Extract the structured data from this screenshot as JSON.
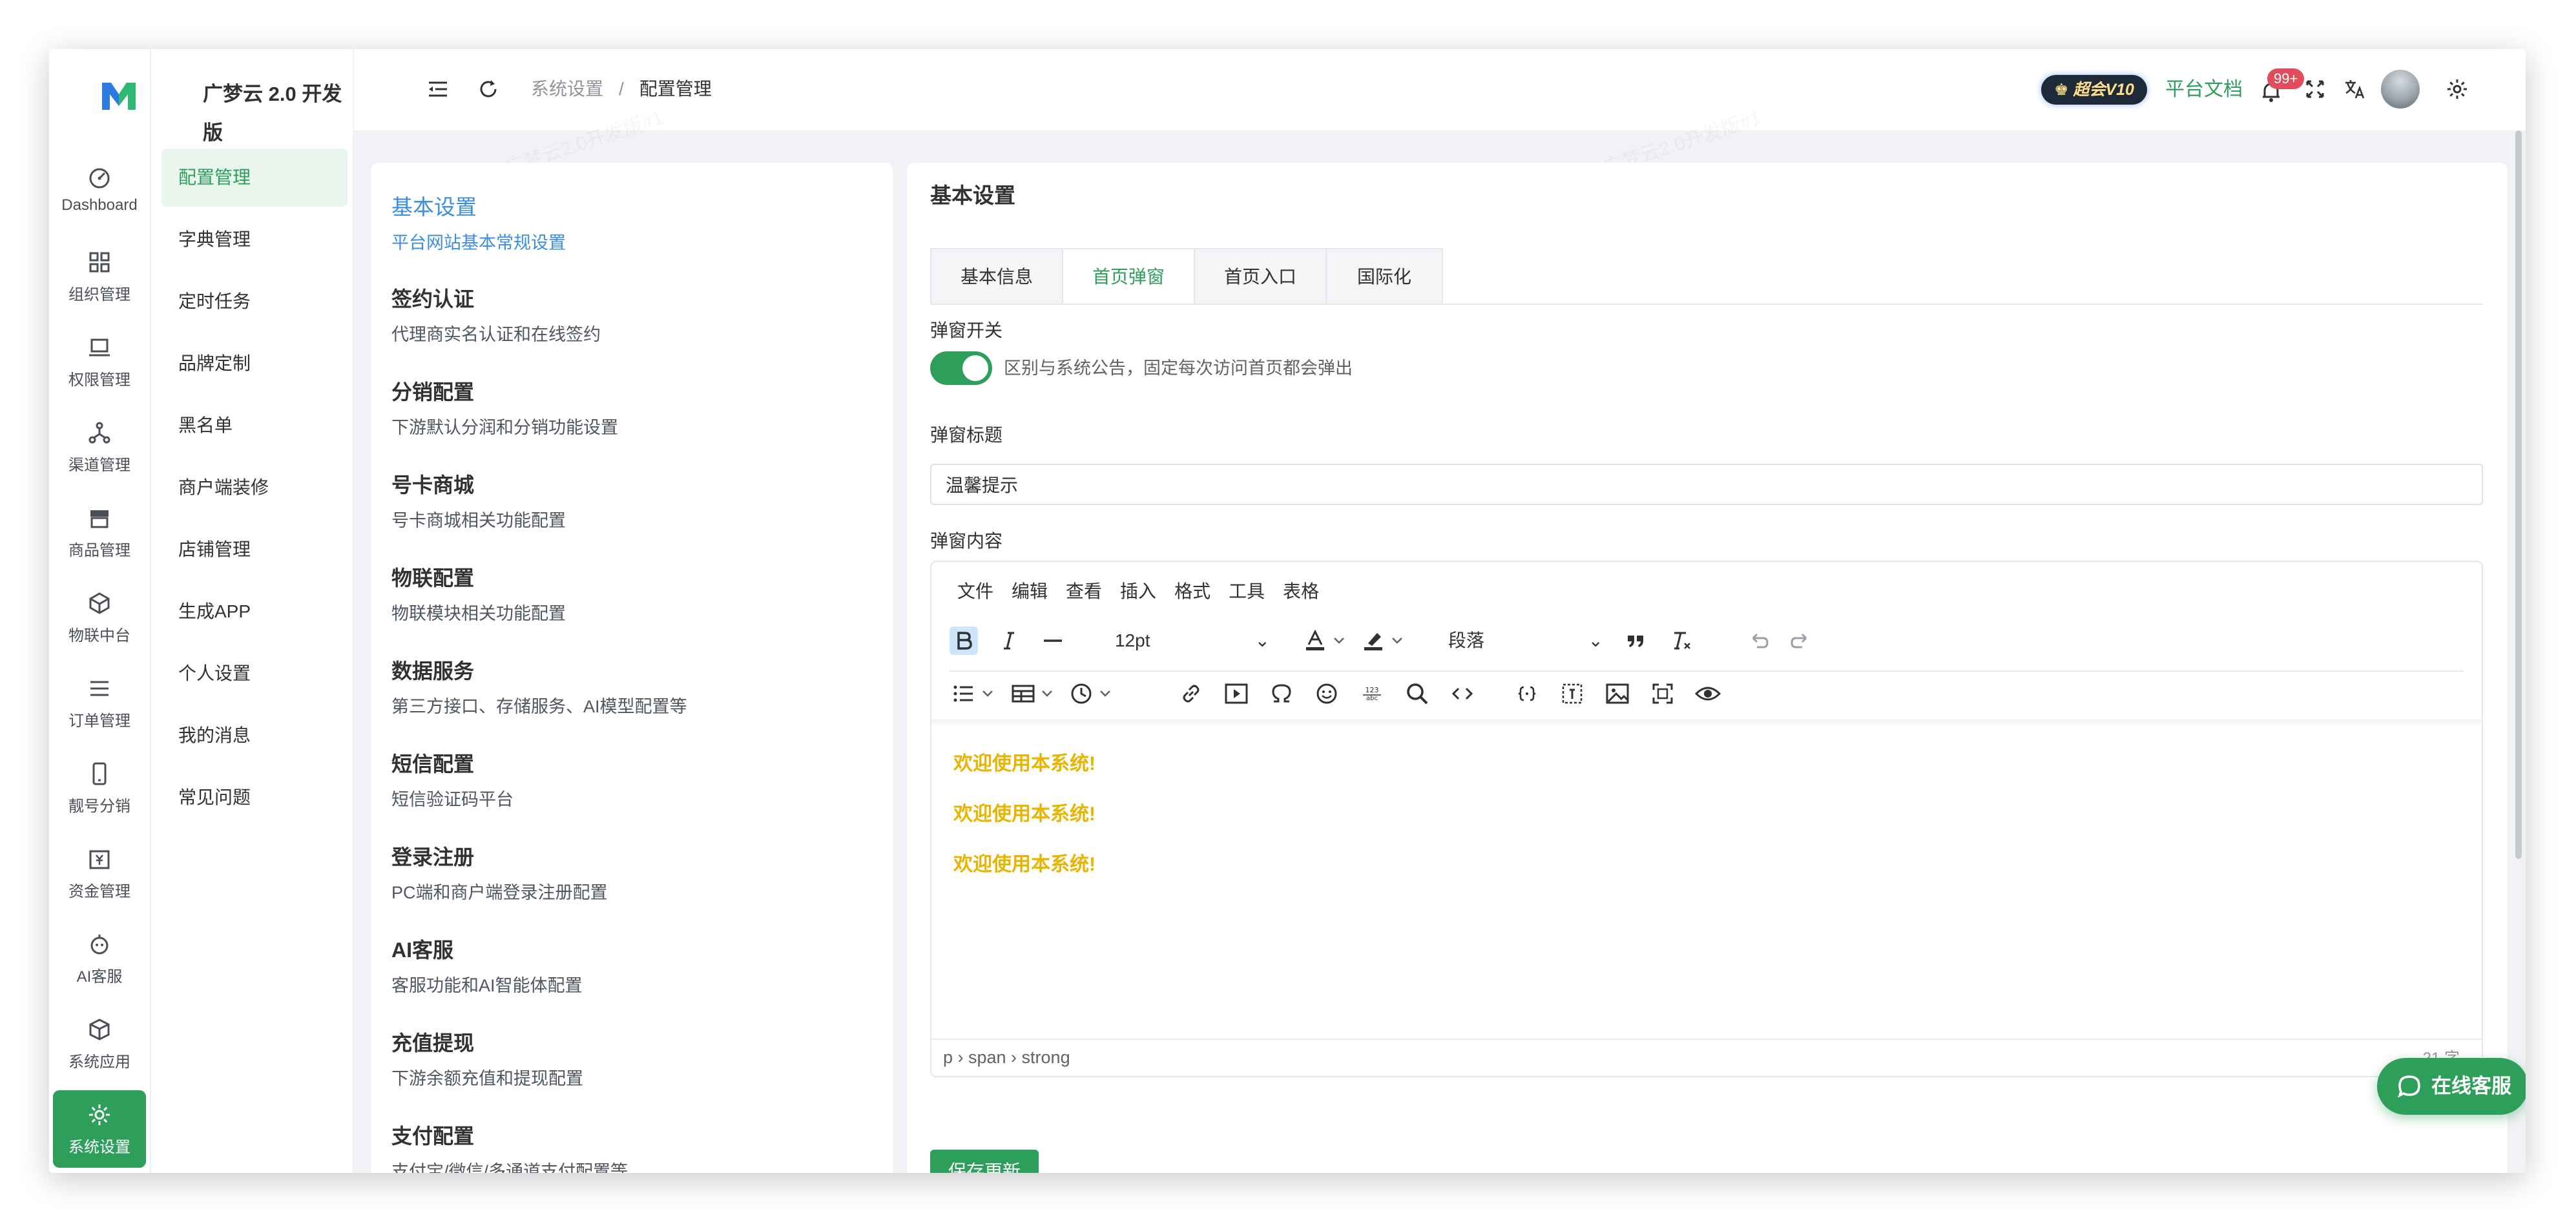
{
  "app": {
    "brand": "广梦云 2.0 开发版",
    "logo_icon": "m-logo-icon",
    "watermark": "广梦云2.0开发版#1"
  },
  "rail": {
    "items": [
      {
        "label": "Dashboard",
        "icon": "dashboard-icon"
      },
      {
        "label": "组织管理",
        "icon": "grid-icon"
      },
      {
        "label": "权限管理",
        "icon": "laptop-icon"
      },
      {
        "label": "渠道管理",
        "icon": "network-icon"
      },
      {
        "label": "商品管理",
        "icon": "shop-icon"
      },
      {
        "label": "物联中台",
        "icon": "cube-icon"
      },
      {
        "label": "订单管理",
        "icon": "list-icon"
      },
      {
        "label": "靓号分销",
        "icon": "phone-icon"
      },
      {
        "label": "资金管理",
        "icon": "wallet-icon"
      },
      {
        "label": "AI客服",
        "icon": "robot-icon"
      },
      {
        "label": "系统应用",
        "icon": "box-icon"
      },
      {
        "label": "系统设置",
        "icon": "gear-icon"
      }
    ],
    "active": "系统设置"
  },
  "submenu": {
    "items": [
      "配置管理",
      "字典管理",
      "定时任务",
      "品牌定制",
      "黑名单",
      "商户端装修",
      "店铺管理",
      "生成APP",
      "个人设置",
      "我的消息",
      "常见问题"
    ],
    "active": "配置管理"
  },
  "header": {
    "breadcrumb": [
      "系统设置",
      "/",
      "配置管理"
    ],
    "vip_badge": "超会V10",
    "docs_link": "平台文档",
    "notify_count": "99+"
  },
  "categories": [
    {
      "title": "基本设置",
      "desc": "平台网站基本常规设置"
    },
    {
      "title": "签约认证",
      "desc": "代理商实名认证和在线签约"
    },
    {
      "title": "分销配置",
      "desc": "下游默认分润和分销功能设置"
    },
    {
      "title": "号卡商城",
      "desc": "号卡商城相关功能配置"
    },
    {
      "title": "物联配置",
      "desc": "物联模块相关功能配置"
    },
    {
      "title": "数据服务",
      "desc": "第三方接口、存储服务、AI模型配置等"
    },
    {
      "title": "短信配置",
      "desc": "短信验证码平台"
    },
    {
      "title": "登录注册",
      "desc": "PC端和商户端登录注册配置"
    },
    {
      "title": "AI客服",
      "desc": "客服功能和AI智能体配置"
    },
    {
      "title": "充值提现",
      "desc": "下游余额充值和提现配置"
    },
    {
      "title": "支付配置",
      "desc": "支付宝/微信/多通道支付配置等"
    }
  ],
  "main": {
    "title": "基本设置",
    "tabs": [
      "基本信息",
      "首页弹窗",
      "首页入口",
      "国际化"
    ],
    "active_tab": "首页弹窗",
    "popup_switch_label": "弹窗开关",
    "popup_switch_on": true,
    "popup_switch_hint": "区别与系统公告，固定每次访问首页都会弹出",
    "popup_title_label": "弹窗标题",
    "popup_title_value": "温馨提示",
    "popup_content_label": "弹窗内容",
    "save_label": "保存更新"
  },
  "editor": {
    "menu": [
      "文件",
      "编辑",
      "查看",
      "插入",
      "格式",
      "工具",
      "表格"
    ],
    "font_size": "12pt",
    "block_format": "段落",
    "content": [
      "欢迎使用本系统!",
      "欢迎使用本系统!",
      "欢迎使用本系统!"
    ],
    "content_color": "#e8b400",
    "status_path": "p › span › strong",
    "word_count": "21 字"
  },
  "chat": {
    "label": "在线客服",
    "icon": "chat-bubble-icon"
  },
  "colors": {
    "brand": "#2e9e5b",
    "link": "#3c8ee0",
    "badge": "#e14d5c"
  }
}
